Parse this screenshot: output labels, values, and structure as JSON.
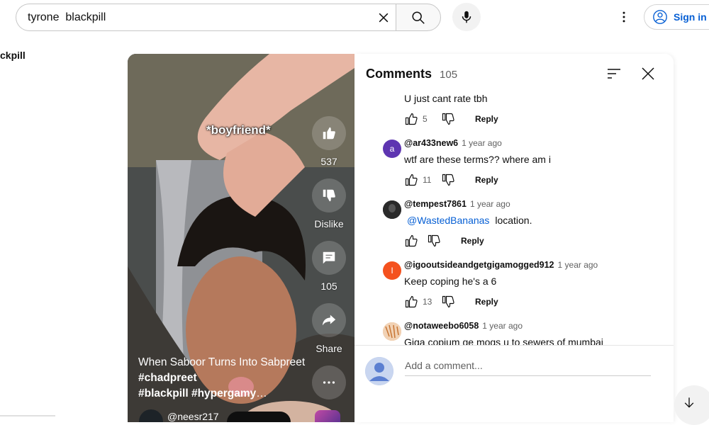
{
  "search": {
    "value": "tyrone  blackpill",
    "clear_icon": "close-icon",
    "search_icon": "search-icon",
    "mic_icon": "mic-icon"
  },
  "header": {
    "more_icon": "more-vert-icon",
    "signin_label": "Sign in",
    "signin_icon": "account-icon"
  },
  "left_fragment": "ckpill",
  "short": {
    "caption": "*boyfriend*",
    "like_count": "537",
    "dislike_label": "Dislike",
    "comment_count": "105",
    "share_label": "Share",
    "title_plain": "When Saboor Turns Into Sabpreet ",
    "title_tag1": "#chadpreet",
    "title_tag2": "#blackpill",
    "title_tag3": "#hypergamy",
    "title_ellipsis": "…",
    "channel_partial": "@neesr217"
  },
  "comments_panel": {
    "title": "Comments",
    "count": "105",
    "sort_icon": "sort-icon",
    "close_icon": "close-icon",
    "comments": [
      {
        "author": "",
        "time": "",
        "text": "U just cant rate tbh",
        "likes": "5",
        "reply": "Reply",
        "avatar_letter": "",
        "avatar_color": ""
      },
      {
        "author": "@ar433new6",
        "time": "1 year ago",
        "text": "wtf are these terms?? where am i",
        "likes": "11",
        "reply": "Reply",
        "avatar_letter": "a",
        "avatar_color": "#5e35b1"
      },
      {
        "author": "@tempest7861",
        "time": "1 year ago",
        "mention": "@WastedBananas",
        "text": "location.",
        "likes": "",
        "reply": "Reply",
        "avatar_letter": "",
        "avatar_color": "#222222"
      },
      {
        "author": "@igooutsideandgetgigamogged912",
        "time": "1 year ago",
        "text": "Keep coping he's a 6",
        "likes": "13",
        "reply": "Reply",
        "avatar_letter": "I",
        "avatar_color": "#f4511e"
      },
      {
        "author": "@notaweebo6058",
        "time": "1 year ago",
        "text": "Giga copium ge mogs u to sewers of mumbai",
        "likes": "",
        "reply": "",
        "avatar_letter": "",
        "avatar_color": "#e8a46b"
      }
    ],
    "add_comment_placeholder": "Add a comment...",
    "down_icon": "arrow-down-icon"
  }
}
